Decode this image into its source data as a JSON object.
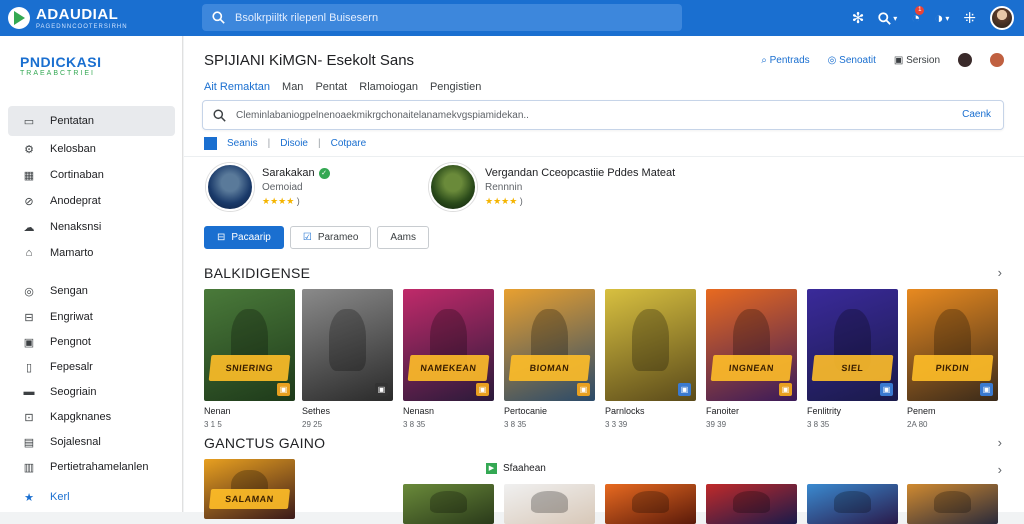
{
  "topbar": {
    "brand": "ADAUDIAL",
    "brand_sub": "PAGEDNNCOOTERSIRHN",
    "search_placeholder": "Bsolkrpiiltk rilepenl Buisesern",
    "icons": [
      "settings-icon",
      "search-icon",
      "notifications-icon",
      "help-icon",
      "apps-icon"
    ],
    "badge_count": "1"
  },
  "sidebar": {
    "brand": "PNDICKASI",
    "brand_sub": "TRAEABCTRIEI",
    "items": [
      {
        "label": "Pentatan",
        "icon": "▭",
        "active": true
      },
      {
        "label": "Kelosban",
        "icon": "⚙"
      },
      {
        "label": "Cortinaban",
        "icon": "▦"
      },
      {
        "label": "Anodeprat",
        "icon": "⊘"
      },
      {
        "label": "Nenaksnsi",
        "icon": "☁"
      },
      {
        "label": "Mamarto",
        "icon": "⌂"
      },
      {
        "label": "Sengan",
        "icon": "◎"
      },
      {
        "label": "Engriwat",
        "icon": "⊟"
      },
      {
        "label": "Pengnot",
        "icon": "▣"
      },
      {
        "label": "Fepesalr",
        "icon": "▯"
      },
      {
        "label": "Seogriain",
        "icon": "▬"
      },
      {
        "label": "Kapgknanes",
        "icon": "⊡"
      },
      {
        "label": "Sojalesnal",
        "icon": "▤"
      },
      {
        "label": "Pertietrahamelanlen",
        "icon": "▥"
      },
      {
        "label": "Kerl",
        "icon": "★"
      }
    ]
  },
  "main": {
    "title": "SPIJIANI KiMGN- Esekolt Sans",
    "header_actions": [
      "Pentrads",
      "Senoatit",
      "Sersion"
    ],
    "filters": [
      "Ait Remaktan",
      "Man",
      "Pentat",
      "Rlamoiogan",
      "Pengistien"
    ],
    "search_value": "Cleminlabaniogpelnenoaekmikrgchonaitelanamekvgspiamidekan..",
    "search_button": "Caenk",
    "tabs": [
      "Seanis",
      "Disoie",
      "Cotpare"
    ],
    "profiles": [
      {
        "name": "Sarakakan",
        "sub": "Oemoiad",
        "stars": "★★★★",
        "count": ")"
      },
      {
        "name": "Vergandan Cceopcastiie  Pddes Mateat",
        "sub": "Rennnin",
        "stars": "★★★★",
        "count": ")"
      }
    ],
    "actions": [
      "Pacaarip",
      "Parameo",
      "Aams"
    ],
    "sections": [
      {
        "title": "BALKIDIGENSE",
        "games": [
          {
            "name": "Nenan",
            "count": "3 1 5",
            "banner": "SNIERING",
            "colors": [
              "#4a7a3a",
              "#1e3a1a"
            ],
            "corner": "#e8a020"
          },
          {
            "name": "Sethes",
            "count": "29 25",
            "banner": "",
            "colors": [
              "#8a8a8a",
              "#2a2a2a"
            ],
            "corner": "#333"
          },
          {
            "name": "Nenasn",
            "count": "3 8 35",
            "banner": "NAMEKEAN",
            "colors": [
              "#c02a6a",
              "#2a1a3a"
            ],
            "corner": "#e8a020"
          },
          {
            "name": "Pertocanie",
            "count": "3 8 35",
            "banner": "BIOMAN",
            "colors": [
              "#e8a030",
              "#2a4a6a"
            ],
            "corner": "#e8a020"
          },
          {
            "name": "Parnlocks",
            "count": "3 3 39",
            "banner": "",
            "colors": [
              "#d8c040",
              "#5a4a1a"
            ],
            "corner": "#3a7ad0"
          },
          {
            "name": "Fanoiter",
            "count": "39 39",
            "banner": "INGNEAN",
            "colors": [
              "#e86a20",
              "#3a1a5a"
            ],
            "corner": "#e8a020"
          },
          {
            "name": "Fenlitrity",
            "count": "3 8 35",
            "banner": "SIEL",
            "colors": [
              "#3a2a9a",
              "#1a1a4a"
            ],
            "corner": "#3a7ad0"
          },
          {
            "name": "Penem",
            "count": "2A 80",
            "banner": "PIKDIN",
            "colors": [
              "#e88a20",
              "#3a2a1a"
            ],
            "corner": "#3a7ad0"
          }
        ]
      },
      {
        "title": "GANCTUS GAINO",
        "sub_label": "Sfaahean",
        "games": [
          {
            "banner": "SALAMAN",
            "colors": [
              "#e8a020",
              "#3a1a1a"
            ]
          },
          {
            "banner": "",
            "colors": [
              "#f4f4f4",
              "#d0d0d0"
            ]
          },
          {
            "banner": "",
            "colors": [
              "#6a8a3a",
              "#2a3a1a"
            ]
          },
          {
            "banner": "",
            "colors": [
              "#f0f0f0",
              "#d8c8b8"
            ]
          },
          {
            "banner": "",
            "colors": [
              "#e86a20",
              "#5a1a0a"
            ]
          },
          {
            "banner": "",
            "colors": [
              "#c02a2a",
              "#1a1a4a"
            ]
          },
          {
            "banner": "",
            "colors": [
              "#3a8ad0",
              "#2a1a4a"
            ]
          },
          {
            "banner": "",
            "colors": [
              "#d08a30",
              "#2a2a3a"
            ]
          }
        ]
      }
    ]
  }
}
